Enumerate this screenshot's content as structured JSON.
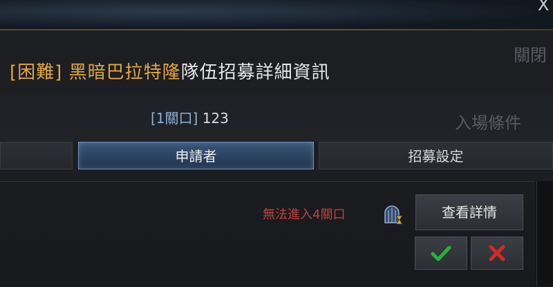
{
  "window": {
    "close_glyph": "X"
  },
  "background_labels": {
    "close_label": "關閉",
    "entry_conditions": "入場條件"
  },
  "title": {
    "difficulty": "[困難]",
    "dungeon": "黑暗巴拉特隆",
    "suffix": "隊伍招募詳細資訊"
  },
  "gate": {
    "bracket_label": "[1關口]",
    "value": "123"
  },
  "tabs": [
    {
      "label": "",
      "active": false
    },
    {
      "label": "申請者",
      "active": true
    },
    {
      "label": "招募設定",
      "active": false
    }
  ],
  "applicant": {
    "warning": "無法進入4關口",
    "detail_button": "查看詳情",
    "gate_icon": "gate-hourglass-icon",
    "accept_icon": "checkmark-icon",
    "reject_icon": "x-icon"
  },
  "colors": {
    "gold": "#e6a73a",
    "warning_red": "#c0413a",
    "accept_green": "#27b03a",
    "reject_red": "#d12a2a",
    "active_tab": "#2b4260"
  }
}
